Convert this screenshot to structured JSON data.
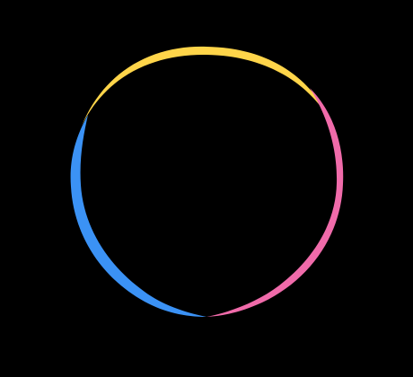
{
  "background_color": "#000000",
  "ring": {
    "segments": [
      {
        "name": "yellow-arc",
        "color": "#FFD54A"
      },
      {
        "name": "pink-arc",
        "color": "#F06BAA"
      },
      {
        "name": "blue-arc",
        "color": "#3B92F5"
      }
    ]
  }
}
